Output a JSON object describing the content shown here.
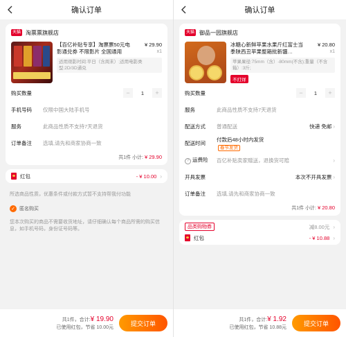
{
  "left": {
    "title": "确认订单",
    "shop": {
      "badge": "天猫",
      "name": "淘票票旗舰店"
    },
    "product": {
      "title": "【百亿补贴专享】淘票票50元电影通兑券 不限影片 全国通用",
      "price": "¥ 29.90",
      "qty": "x1",
      "spec": "适用观影时间:平日（含周末）;适用电影类型:2D/3D通兑"
    },
    "rows": [
      {
        "label": "购买数量",
        "type": "stepper",
        "value": "1",
        "minus": "−",
        "plus": "+"
      },
      {
        "label": "手机号码",
        "value": "仅限中国大陆手机号"
      },
      {
        "label": "服务",
        "value": "此商品性质不支持7天退货"
      },
      {
        "label": "订单备注",
        "value": "选填,请先和商家协商一致"
      }
    ],
    "total": {
      "count_text": "共1件",
      "subtotal_label": "小计:",
      "subtotal": "¥ 29.90"
    },
    "red_packet": {
      "label": "红包",
      "amount": "- ¥ 10.00"
    },
    "note1": "所选商品性质，优惠条件或付款方式暂不支持帮我付功能",
    "anonymous": "匿名购买",
    "note2": "您本次购买的商品不需要收货地址，请仔细确认每个商品所需的购买信息，如手机号码，身份证号码等。",
    "bottom": {
      "count": "共1件，",
      "total_label": "合计:",
      "total": "¥ 19.90",
      "used": "已使用红包，节省 10.00元",
      "submit": "提交订单"
    }
  },
  "right": {
    "title": "确认订单",
    "shop": {
      "badge": "天猫",
      "name": "御品一园旗舰店"
    },
    "product": {
      "title": "冰糖心新鲜苹果水果斤红富士当季陕西丑苹果整箱批新疆…",
      "price": "¥ 20.80",
      "qty": "x1",
      "spec": "苹果果径:75mm（含）-80mm(不含);重量（不含箱）:3斤;",
      "tag": "不打烊"
    },
    "rows": [
      {
        "label": "购买数量",
        "type": "stepper",
        "value": "1",
        "minus": "−",
        "plus": "+"
      },
      {
        "label": "服务",
        "value": "此商品性质不支持7天退货"
      },
      {
        "label": "配送方式",
        "value": "普通配送",
        "end": "快递 免邮"
      },
      {
        "label": "配送时间",
        "value": "付款后48小时内发货",
        "tag": "春节发货"
      },
      {
        "label": "运费险",
        "value": "百亿补贴卖家赠送，退换货可赔",
        "qa": "?"
      },
      {
        "label": "开具发票",
        "value": "",
        "end": "本次不开具发票"
      },
      {
        "label": "订单备注",
        "value": "选填,请先和商家协商一致"
      }
    ],
    "total": {
      "count_text": "共1件",
      "subtotal_label": "小计:",
      "subtotal": "¥ 20.80"
    },
    "coupon": {
      "label": "品类购物券",
      "amount": "减8.00元"
    },
    "red_packet": {
      "label": "红包",
      "amount": "- ¥ 10.88"
    },
    "bottom": {
      "count": "共1件，",
      "total_label": "合计:",
      "total": "¥ 1.92",
      "used": "已使用红包，节省 10.88元",
      "submit": "提交订单"
    }
  },
  "colors": {
    "accent": "#ff6a00",
    "red": "#e4002b"
  },
  "icons": {
    "back": "chevron-left-icon",
    "chev": "chevron-right-icon"
  }
}
